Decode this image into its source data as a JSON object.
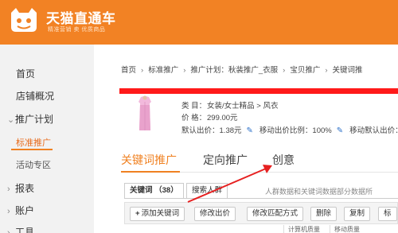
{
  "header": {
    "brand": "天猫直通车",
    "slogan": "精准营销 卖 优质商品"
  },
  "sidebar": {
    "items": [
      {
        "label": "首页",
        "expandable": false
      },
      {
        "label": "店铺概况",
        "expandable": false
      },
      {
        "label": "推广计划",
        "expandable": true,
        "expanded": true
      },
      {
        "label": "标准推广",
        "sub": true,
        "active": true
      },
      {
        "label": "活动专区",
        "sub": true
      },
      {
        "label": "报表",
        "expandable": true
      },
      {
        "label": "账户",
        "expandable": true
      },
      {
        "label": "工具",
        "expandable": true
      }
    ]
  },
  "breadcrumb": [
    "首页",
    "标准推广",
    "推广计划：秋装推广_衣服",
    "宝贝推广",
    "关键词推"
  ],
  "product": {
    "category_label": "类 目：",
    "category_value": "女装/女士精品 > 风衣",
    "price_label": "价 格：",
    "price_value": "299.00元",
    "default_bid_label": "默认出价：",
    "default_bid_value": "1.38元",
    "mobile_ratio_label": "移动出价比例：",
    "mobile_ratio_value": "100%",
    "mobile_default_label": "移动默认出价："
  },
  "main_tabs": [
    {
      "label": "关键词推广",
      "active": true
    },
    {
      "label": "定向推广",
      "active": false
    },
    {
      "label": "创意",
      "active": false
    }
  ],
  "sub_tabs": [
    {
      "label": "关键词 （38）",
      "active": true
    },
    {
      "label": "搜索人群",
      "active": false
    }
  ],
  "sub_tab_note": "人群数据和关键词数据部分数据所",
  "toolbar": {
    "add_keyword": "添加关键词",
    "modify_bid": "修改出价",
    "modify_match": "修改匹配方式",
    "delete": "删除",
    "copy": "复制",
    "more": "标"
  },
  "grid_headers": [
    "计算机质量",
    "移动质量"
  ],
  "colors": {
    "brand_orange": "#f28224",
    "accent_orange": "#f08121",
    "annotation_red": "#ff1a1a",
    "link_blue": "#2a6fc9"
  }
}
